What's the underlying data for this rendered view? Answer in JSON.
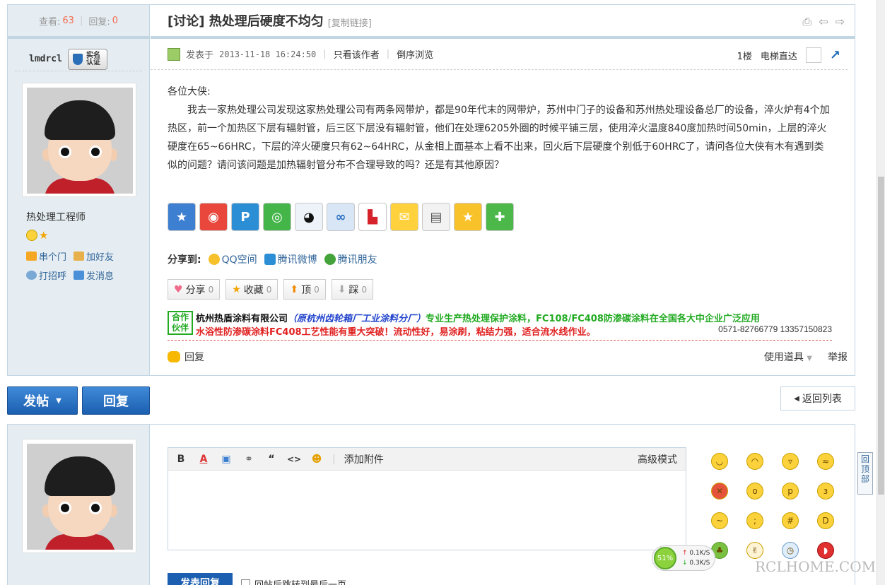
{
  "thread": {
    "views_label": "查看:",
    "views": "63",
    "replies_label": "回复:",
    "replies": "0",
    "title": "[讨论] 热处理后硬度不均匀",
    "copy_link": "[复制链接]"
  },
  "author": {
    "name": "lmdrcl",
    "badge": "实名认证",
    "title": "热处理工程师",
    "links": {
      "visit": "串个门",
      "add_friend": "加好友",
      "greet": "打招呼",
      "message": "发消息"
    }
  },
  "post": {
    "posted_label": "发表于",
    "time": "2013-11-18 16:24:50",
    "only_author": "只看该作者",
    "reverse": "倒序浏览",
    "floor": "1楼",
    "elevator": "电梯直达",
    "greeting": "各位大侠:",
    "body": "我去一家热处理公司发现这家热处理公司有两条网带炉，都是90年代末的网带炉，苏州中门子的设备和苏州热处理设备总厂的设备，淬火炉有4个加热区，前一个加热区下层有辐射管，后三区下层没有辐射管，他们在处理6205外圈的时候平铺三层，使用淬火温度840度加热时间50min，上层的淬火硬度在65~66HRC，下层的淬火硬度只有62~64HRC，从金相上面基本上看不出来，回火后下层硬度个别低于60HRC了，请问各位大侠有木有遇到类似的问题？请问该问题是加热辐射管分布不合理导致的吗？还是有其他原因？"
  },
  "share": {
    "label": "分享到:",
    "qzone": "QQ空间",
    "weibo": "腾讯微博",
    "friends": "腾讯朋友"
  },
  "actions": {
    "share": "分享",
    "share_count": "0",
    "fav": "收藏",
    "fav_count": "0",
    "up": "顶",
    "up_count": "0",
    "down": "踩",
    "down_count": "0"
  },
  "ad": {
    "tag": "合作伙伴",
    "company": "杭州热盾涂料有限公司",
    "former": "（原杭州齿轮箱厂工业涂料分厂）",
    "line1_rest": "专业生产热处理保护涂料，FC108/FC408防渗碳涂料在全国各大中企业广泛应用",
    "line2": "水浴性防渗碳涂料FC408工艺性能有重大突破！流动性好，易涂刷，粘结力强，适合流水线作业。",
    "phone": "0571-82766779 13357150823"
  },
  "footer": {
    "reply": "回复",
    "tools": "使用道具",
    "report": "举报"
  },
  "buttons": {
    "post": "发帖",
    "reply": "回复",
    "back": "返回列表"
  },
  "editor": {
    "attach": "添加附件",
    "advanced": "高级模式",
    "submit": "发表回复",
    "jump_label": "回帖后跳转到最后一页"
  },
  "widget": {
    "percent": "51%",
    "up": "0.1K/S",
    "down": "0.3K/S"
  },
  "totop": "回顶部",
  "watermark": "RCLHOME.COM",
  "colors": {
    "border": "#c2d5e3",
    "side_bg": "#e5edf2",
    "link": "#336699",
    "accent": "#1c5fb0"
  }
}
